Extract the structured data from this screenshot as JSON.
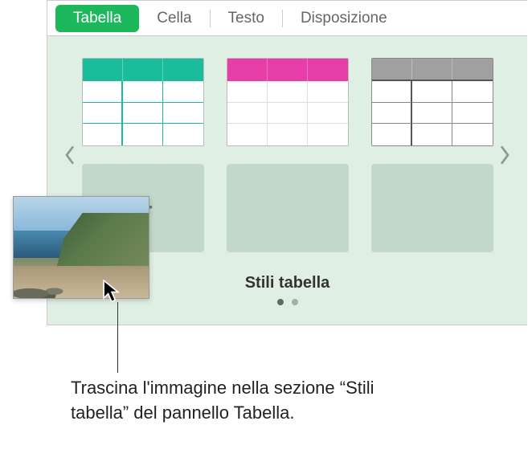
{
  "tabs": {
    "tabella": "Tabella",
    "cella": "Cella",
    "testo": "Testo",
    "disposizione": "Disposizione"
  },
  "section": {
    "label": "Stili tabella"
  },
  "slots": {
    "add_symbol": "+"
  },
  "callout": {
    "text": "Trascina l'immagine nella sezione “Stili tabella” del pannello Tabella."
  }
}
